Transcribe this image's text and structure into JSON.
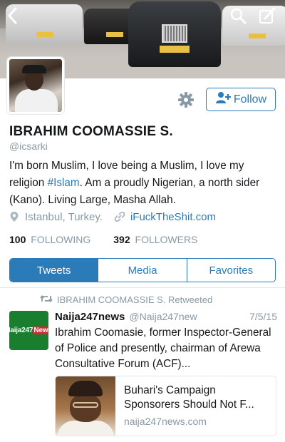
{
  "header": {
    "icons": [
      "chevron-left-icon",
      "search-icon",
      "compose-icon"
    ]
  },
  "profile": {
    "name": "IBRAHIM COOMASSIE S.",
    "handle": "@icsarki",
    "follow_label": "Follow",
    "bio_part1": "I'm born Muslim, I love being a Muslim, I love my religion ",
    "bio_hashtag": "#Islam",
    "bio_part2": ". Am a proudly Nigerian, a north sider (Kano). Living Large, Masha Allah.",
    "location": "Istanbul, Turkey.",
    "website": "iFuckTheShit.com",
    "following_count": "100",
    "following_label": "FOLLOWING",
    "followers_count": "392",
    "followers_label": "FOLLOWERS"
  },
  "tabs": [
    {
      "label": "Tweets",
      "active": true
    },
    {
      "label": "Media",
      "active": false
    },
    {
      "label": "Favorites",
      "active": false
    }
  ],
  "timeline": {
    "retweet_notice": "IBRAHIM COOMASSIE S. Retweeted",
    "tweet": {
      "avatar_text_a": "Naija247",
      "avatar_text_b": "News",
      "author_name": "Naija247news",
      "author_handle": "@Naija247new",
      "date": "7/5/15",
      "text": "Ibrahim Coomasie, former Inspector-General of Police and presently, chairman of Arewa Consultative Forum (ACF)...",
      "card": {
        "title": "Buhari's Campaign Sponsorers Should Not F...",
        "domain": "naija247news.com"
      }
    }
  },
  "colors": {
    "accent": "#2b7bb9",
    "muted": "#8899a6",
    "text": "#14171a"
  }
}
